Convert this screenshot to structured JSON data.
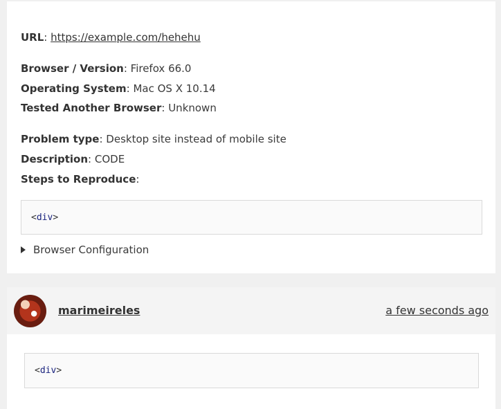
{
  "issue": {
    "url_label": "URL",
    "url": "https://example.com/hehehu",
    "browser_label": "Browser / Version",
    "browser_value": "Firefox 66.0",
    "os_label": "Operating System",
    "os_value": "Mac OS X 10.14",
    "tested_label": "Tested Another Browser",
    "tested_value": "Unknown",
    "problem_label": "Problem type",
    "problem_value": "Desktop site instead of mobile site",
    "description_label": "Description",
    "description_value": "CODE",
    "steps_label": "Steps to Reproduce",
    "code_open": "<",
    "code_tag": "div",
    "code_close": ">",
    "details_label": "Browser Configuration"
  },
  "comment": {
    "username": "marimeireles",
    "timestamp": "a few seconds ago",
    "code_open": "<",
    "code_tag": "div",
    "code_close": ">"
  }
}
